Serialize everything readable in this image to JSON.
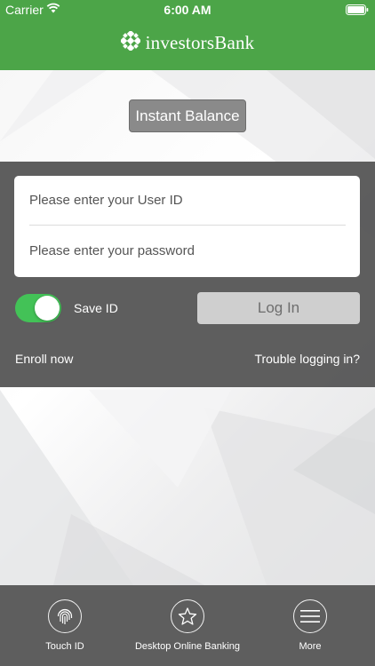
{
  "status_bar": {
    "carrier": "Carrier",
    "time": "6:00 AM"
  },
  "header": {
    "brand_name": "investorsBank",
    "brand_color": "#4ca548"
  },
  "instant_balance": {
    "label": "Instant Balance"
  },
  "login": {
    "user_id_placeholder": "Please enter your User ID",
    "password_placeholder": "Please enter your password",
    "save_id_label": "Save ID",
    "save_id_enabled": true,
    "login_button_label": "Log In",
    "enroll_label": "Enroll now",
    "trouble_label": "Trouble logging in?",
    "toggle_color": "#43c257"
  },
  "tabs": [
    {
      "label": "Touch ID",
      "icon": "fingerprint-icon"
    },
    {
      "label": "Desktop Online Banking",
      "icon": "star-icon"
    },
    {
      "label": "More",
      "icon": "menu-icon"
    }
  ]
}
